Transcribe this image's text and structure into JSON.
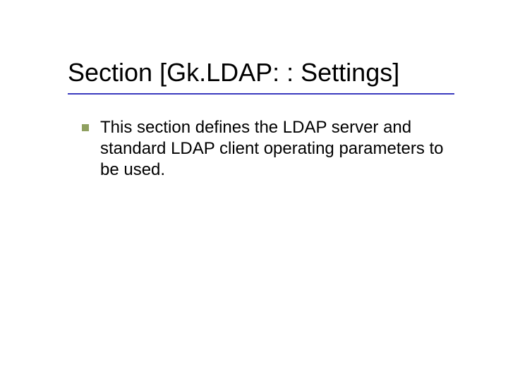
{
  "title": "Section [Gk.LDAP: : Settings]",
  "bullets": [
    {
      "text": "This section defines the LDAP server and standard LDAP client operating parameters to be used."
    }
  ],
  "colors": {
    "underline": "#3b3bbf",
    "bullet": "#8fa060"
  }
}
